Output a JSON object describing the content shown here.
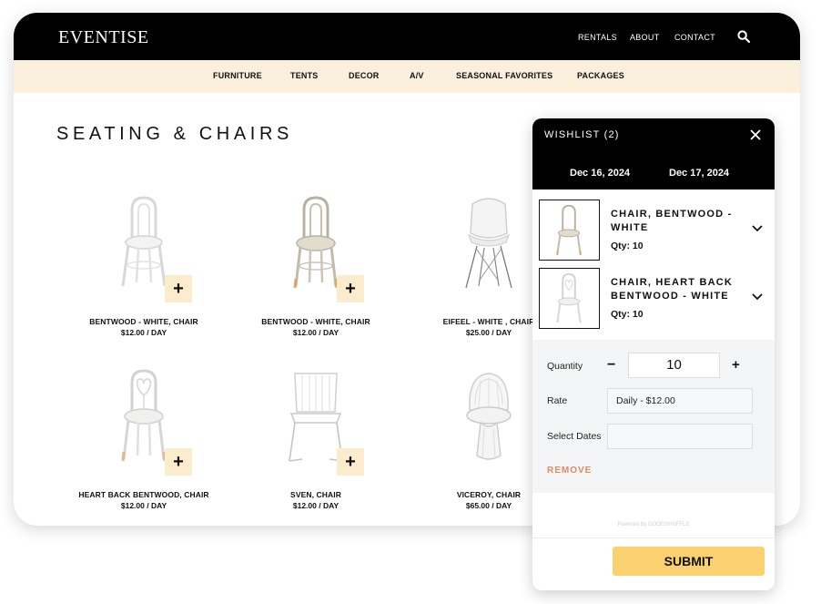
{
  "header": {
    "logo": "EVENTISE",
    "nav": [
      "RENTALS",
      "ABOUT",
      "CONTACT"
    ],
    "search_icon": "search-icon"
  },
  "categories": [
    "FURNITURE",
    "TENTS",
    "DECOR",
    "A/V",
    "SEASONAL FAVORITES",
    "PACKAGES"
  ],
  "page_title": "SEATING & CHAIRS",
  "products": [
    {
      "name": "BENTWOOD - WHITE, CHAIR",
      "price": "$12.00 / DAY",
      "add": "+"
    },
    {
      "name": "BENTWOOD - WHITE, CHAIR",
      "price": "$12.00 / DAY",
      "add": "+"
    },
    {
      "name": "EIFEEL - WHITE , CHAIR",
      "price": "$25.00 / DAY",
      "add": "+"
    },
    {
      "name": "HEART BACK BENTWOOD,  CHAIR",
      "price": "$12.00 / DAY",
      "add": "+"
    },
    {
      "name": "SVEN, CHAIR",
      "price": "$12.00 / DAY",
      "add": "+"
    },
    {
      "name": "VICEROY, CHAIR",
      "price": "$65.00 / DAY",
      "add": "+"
    }
  ],
  "wishlist": {
    "title": "WISHLIST (2)",
    "start_date": "Dec 16, 2024",
    "end_date": "Dec 17, 2024",
    "items": [
      {
        "name": "CHAIR, BENTWOOD - WHITE",
        "qty": "Qty: 10"
      },
      {
        "name": "CHAIR, HEART BACK BENTWOOD - WHITE",
        "qty": "Qty: 10"
      }
    ],
    "editor": {
      "quantity_label": "Quantity",
      "minus": "−",
      "quantity_value": "10",
      "plus": "+",
      "rate_label": "Rate",
      "rate_value": "Daily - $12.00",
      "dates_label": "Select Dates",
      "dates_value": "",
      "remove_label": "REMOVE"
    },
    "powered_by": "Powered by GOODSHUFFLE",
    "submit_label": "SUBMIT"
  },
  "colors": {
    "header_bg": "#000000",
    "category_bar_bg": "#faf0dc",
    "add_button_bg": "#faeccd",
    "submit_bg": "#fbd06f",
    "remove_text": "#e28a62"
  }
}
